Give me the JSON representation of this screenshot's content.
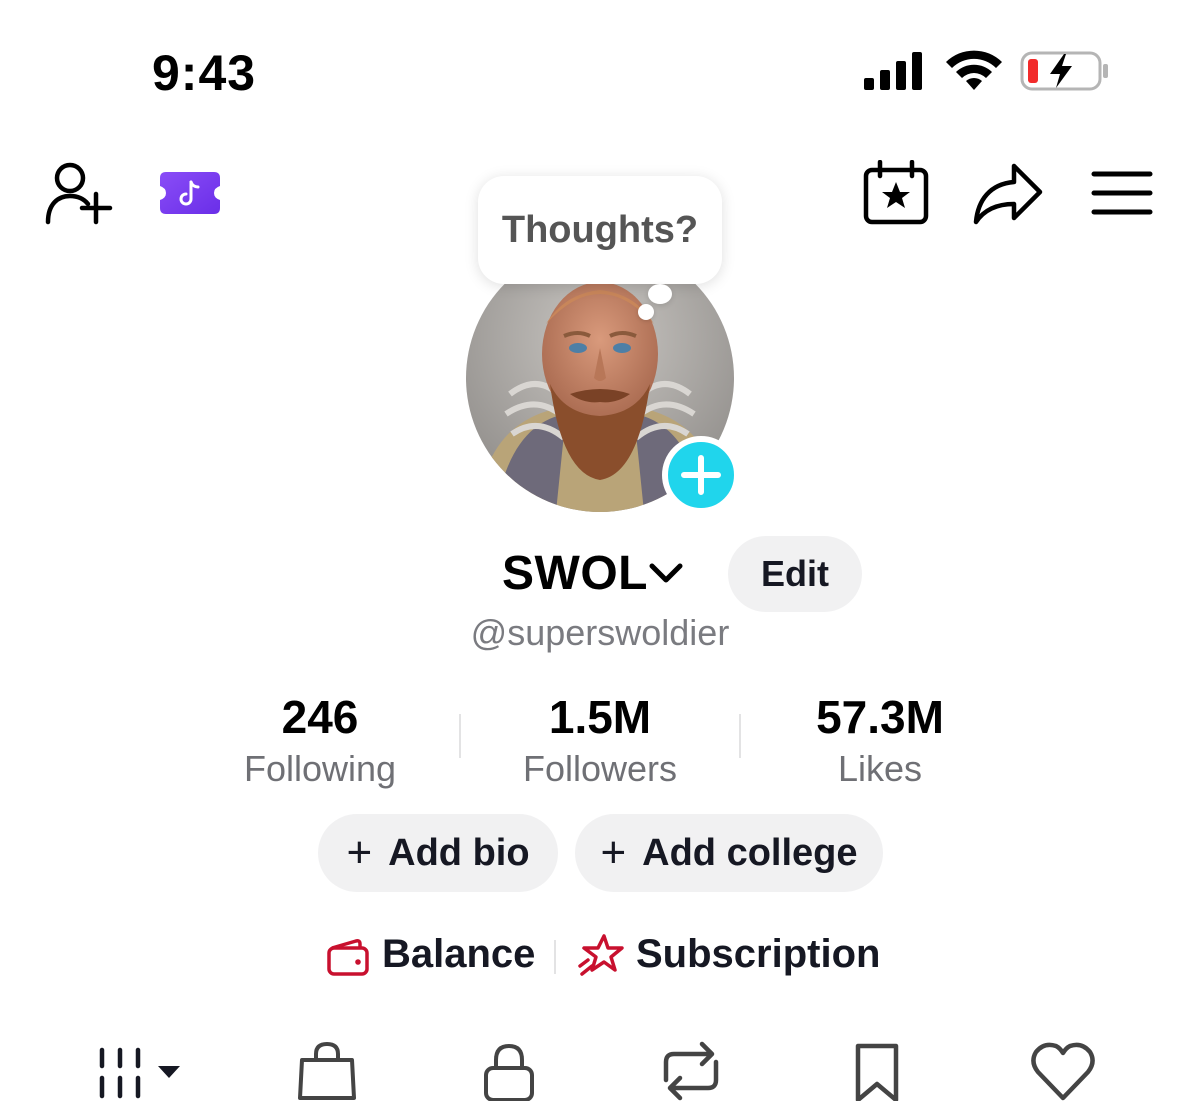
{
  "status_bar": {
    "time": "9:43"
  },
  "bubble": {
    "text": "Thoughts?"
  },
  "profile": {
    "display_name": "SWOL",
    "edit_label": "Edit",
    "handle": "@superswoldier"
  },
  "stats": [
    {
      "value": "246",
      "label": "Following"
    },
    {
      "value": "1.5M",
      "label": "Followers"
    },
    {
      "value": "57.3M",
      "label": "Likes"
    }
  ],
  "actions": {
    "add_bio": "Add bio",
    "add_college": "Add college",
    "plus": "+"
  },
  "links": {
    "balance": "Balance",
    "subscription": "Subscription"
  },
  "colors": {
    "accent_cyan": "#20d5ec",
    "balance_red": "#c8102e",
    "ticket_purple": "#7b3cf0",
    "battery_red": "#f22b2b"
  },
  "icons": {
    "header_left": [
      "add-friend-icon",
      "tiktok-ticket-icon"
    ],
    "header_right": [
      "calendar-star-icon",
      "share-arrow-icon",
      "menu-icon"
    ],
    "tabs": [
      "grid-icon",
      "shopping-bag-icon",
      "lock-icon",
      "repost-icon",
      "bookmark-icon",
      "heart-icon"
    ]
  }
}
